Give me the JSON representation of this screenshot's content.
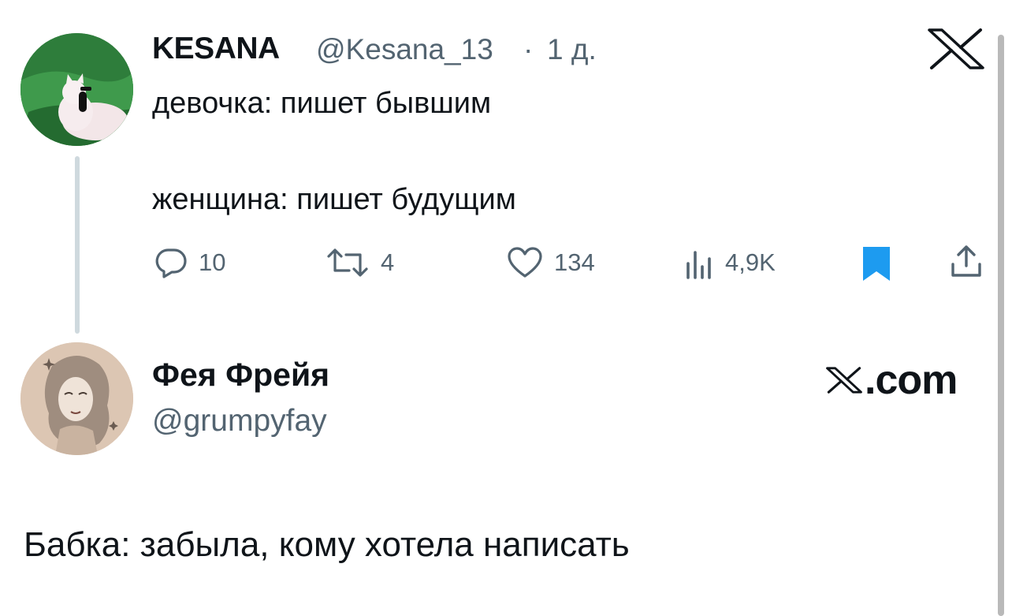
{
  "tweet": {
    "author_name": "KESANA",
    "handle": "@Kesana_13",
    "separator": "·",
    "time": "1 д.",
    "text_line1": "девочка: пишет бывшим",
    "text_line2": "женщина: пишет будущим",
    "stats": {
      "replies": "10",
      "reposts": "4",
      "likes": "134",
      "views": "4,9K"
    },
    "bookmarked": true,
    "colors": {
      "bookmark": "#1d9bf0",
      "secondary_text": "#536471",
      "thread_line": "#cfd9de"
    }
  },
  "reply": {
    "author_name": "Фея Фрейя",
    "handle": "@grumpyfay",
    "brand": ".com",
    "text": "Бабка: забыла, кому хотела написать"
  },
  "icons": [
    "x-logo-icon",
    "reply-icon",
    "repost-icon",
    "like-icon",
    "views-icon",
    "bookmark-icon",
    "share-icon"
  ]
}
